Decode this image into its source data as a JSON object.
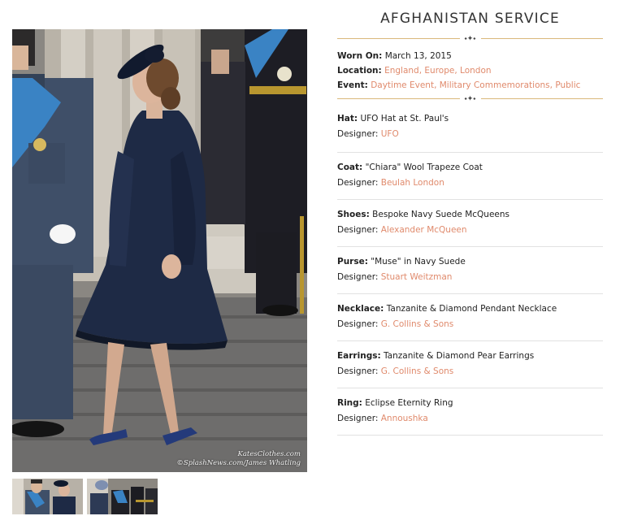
{
  "title": "AFGHANISTAN SERVICE",
  "ornament_glyph": "⬩✦⬩",
  "summary": {
    "worn_on_label": "Worn On:",
    "worn_on_value": "March 13, 2015",
    "location_label": "Location:",
    "locations": [
      "England",
      "Europe",
      "London"
    ],
    "event_label": "Event:",
    "events": [
      "Daytime Event",
      "Military Commemorations",
      "Public"
    ]
  },
  "items": [
    {
      "category": "Hat:",
      "name": "UFO Hat at St. Paul's",
      "designer_label": "Designer:",
      "designer": "UFO"
    },
    {
      "category": "Coat:",
      "name": "\"Chiara\" Wool Trapeze Coat",
      "designer_label": "Designer:",
      "designer": "Beulah London"
    },
    {
      "category": "Shoes:",
      "name": "Bespoke Navy Suede McQueens",
      "designer_label": "Designer:",
      "designer": "Alexander McQueen"
    },
    {
      "category": "Purse:",
      "name": "\"Muse\" in Navy Suede",
      "designer_label": "Designer:",
      "designer": "Stuart Weitzman"
    },
    {
      "category": "Necklace:",
      "name": "Tanzanite & Diamond Pendant Necklace",
      "designer_label": "Designer:",
      "designer": "G. Collins & Sons"
    },
    {
      "category": "Earrings:",
      "name": "Tanzanite & Diamond Pear Earrings",
      "designer_label": "Designer:",
      "designer": "G. Collins & Sons"
    },
    {
      "category": "Ring:",
      "name": "Eclipse Eternity Ring",
      "designer_label": "Designer:",
      "designer": "Annoushka"
    }
  ],
  "photo": {
    "credit_line1": "KatesClothes.com",
    "credit_line2": "©SplashNews.com/James Whatling"
  },
  "colors": {
    "link": "#e08a6c",
    "ornament_line": "#d9b87a",
    "divider": "#e2e2e2",
    "coat_navy": "#1e2a45"
  }
}
